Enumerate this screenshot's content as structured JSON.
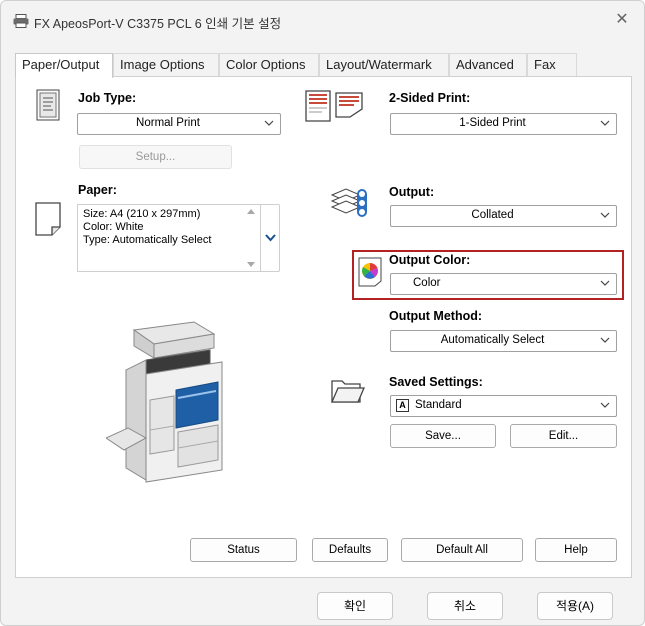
{
  "window": {
    "title": "FX ApeosPort-V C3375 PCL 6 인쇄 기본 설정",
    "close_glyph": "✕"
  },
  "tabs": [
    {
      "label": "Paper/Output",
      "active": true
    },
    {
      "label": "Image Options",
      "active": false
    },
    {
      "label": "Color Options",
      "active": false
    },
    {
      "label": "Layout/Watermark",
      "active": false
    },
    {
      "label": "Advanced",
      "active": false
    },
    {
      "label": "Fax",
      "active": false
    }
  ],
  "job_type": {
    "label": "Job Type:",
    "value": "Normal Print",
    "setup_button": "Setup..."
  },
  "paper": {
    "label": "Paper:",
    "lines": [
      "Size: A4 (210 x 297mm)",
      "Color: White",
      "Type: Automatically Select"
    ]
  },
  "two_sided": {
    "label": "2-Sided Print:",
    "value": "1-Sided Print"
  },
  "output": {
    "label": "Output:",
    "value": "Collated"
  },
  "output_color": {
    "label": "Output Color:",
    "value": "Color"
  },
  "output_method": {
    "label": "Output Method:",
    "value": "Automatically Select"
  },
  "saved_settings": {
    "label": "Saved Settings:",
    "value": "Standard",
    "badge": "A",
    "save_button": "Save...",
    "edit_button": "Edit..."
  },
  "panel_buttons": {
    "status": "Status",
    "defaults": "Defaults",
    "default_all": "Default All",
    "help": "Help"
  },
  "footer": {
    "ok": "확인",
    "cancel": "취소",
    "apply": "적용(A)"
  },
  "colors": {
    "highlight": "#b22222",
    "accent": "#1a5fa8"
  },
  "icons": [
    "printer-icon",
    "close-icon",
    "job-type-icon",
    "two-sided-icon",
    "paper-icon",
    "output-collate-icon",
    "output-color-icon",
    "saved-settings-folder-icon",
    "printer-device-image"
  ]
}
